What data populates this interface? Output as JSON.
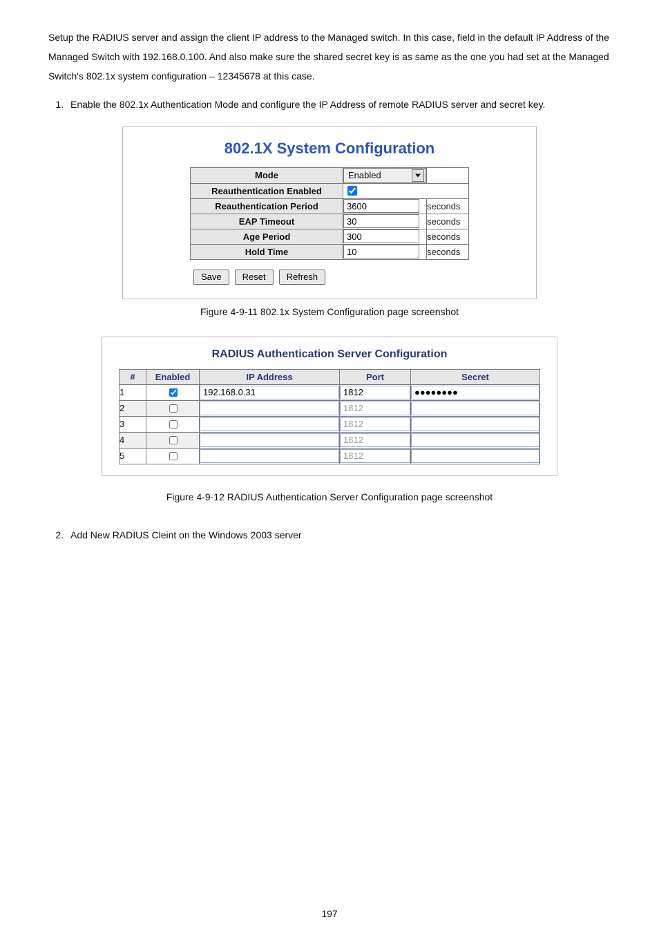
{
  "intro": {
    "para": "Setup the RADIUS server and assign the client IP address to the Managed switch. In this case, field in the default IP Address of the Managed Switch with 192.168.0.100. And also make sure the shared secret key is as same as the one you had set at the Managed Switch's 802.1x system configuration – 12345678 at this case."
  },
  "steps": {
    "s1": "Enable the 802.1x Authentication Mode and configure the IP Address of remote RADIUS server and secret key.",
    "s2": "Add New RADIUS Cleint on the Windows 2003 server"
  },
  "fig1": {
    "title": "802.1X System Configuration",
    "rows": {
      "mode_label": "Mode",
      "mode_value": "Enabled",
      "reauth_enabled_label": "Reauthentication Enabled",
      "reauth_enabled_checked": true,
      "reauth_period_label": "Reauthentication Period",
      "reauth_period_value": "3600",
      "eap_label": "EAP Timeout",
      "eap_value": "30",
      "age_label": "Age Period",
      "age_value": "300",
      "hold_label": "Hold Time",
      "hold_value": "10",
      "unit": "seconds"
    },
    "buttons": {
      "save": "Save",
      "reset": "Reset",
      "refresh": "Refresh"
    },
    "caption": "Figure 4-9-11 802.1x System Configuration page screenshot"
  },
  "fig2": {
    "title": "RADIUS Authentication Server Configuration",
    "headers": {
      "num": "#",
      "enabled": "Enabled",
      "ip": "IP Address",
      "port": "Port",
      "secret": "Secret"
    },
    "rows": [
      {
        "n": "1",
        "enabled": true,
        "ip": "192.168.0.31",
        "port": "1812",
        "secret": "●●●●●●●●",
        "active": true
      },
      {
        "n": "2",
        "enabled": false,
        "ip": "",
        "port": "1812",
        "secret": "",
        "active": false
      },
      {
        "n": "3",
        "enabled": false,
        "ip": "",
        "port": "1812",
        "secret": "",
        "active": false
      },
      {
        "n": "4",
        "enabled": false,
        "ip": "",
        "port": "1812",
        "secret": "",
        "active": false
      },
      {
        "n": "5",
        "enabled": false,
        "ip": "",
        "port": "1812",
        "secret": "",
        "active": false
      }
    ],
    "caption": "Figure 4-9-12 RADIUS Authentication Server Configuration page screenshot"
  },
  "page_number": "197"
}
